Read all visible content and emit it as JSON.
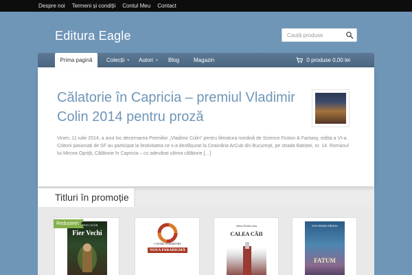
{
  "topbar": {
    "links": [
      "Despre noi",
      "Termeni și condiții",
      "Contul Meu",
      "Contact"
    ]
  },
  "header": {
    "site_title": "Editura Eagle",
    "search_placeholder": "Caută produse"
  },
  "nav": {
    "items": [
      {
        "label": "Prima pagină",
        "active": true,
        "dropdown": false
      },
      {
        "label": "Colecții",
        "active": false,
        "dropdown": true
      },
      {
        "label": "Autori",
        "active": false,
        "dropdown": true
      },
      {
        "label": "Blog",
        "active": false,
        "dropdown": false
      },
      {
        "label": "Magazin",
        "active": false,
        "dropdown": false
      }
    ],
    "cart_label": "0 produse 0,00 lei"
  },
  "featured_post": {
    "title": "Călatorie în Capricia – premiul Vladimir Colin 2014 pentru proză",
    "excerpt": "Vineri, 11 iulie 2014, a avut loc decernarea Premiilor „Vladimir Colin” pentru literatura română de Science Fiction & Fantasy, ediția a VI-a. Cititorii pasionați de SF au participat la festivitatea ce s-a desfășurat la Ceainăria ArCub din Bucureşti, pe strada Batiștei, nr. 14. Romanul lui Mircea Opriță, Călătorie în Capricia – cu adevărat ultima călătorie […]"
  },
  "promotions": {
    "title": "Titluri în promoție",
    "sale_badge": "Reducere!",
    "products": [
      {
        "cover_author": "GEORGE LAZĂR",
        "cover_title": "Fier Vechi"
      },
      {
        "cover_title_top": "O MARE SCHIMBARE",
        "cover_title": "NOUA PARADIGMĂ"
      },
      {
        "cover_author": "Adina Moldoveanu",
        "cover_title": "CALEA CĂII"
      },
      {
        "cover_author": "ANA-MARIA DRAGU",
        "cover_title": "FATUM"
      }
    ]
  },
  "colors": {
    "background": "#6f95b7",
    "topbar": "#0d0d0d",
    "navbar": "#4e6a85",
    "post_title": "#6f95b7",
    "sale_badge": "#84b14c"
  }
}
